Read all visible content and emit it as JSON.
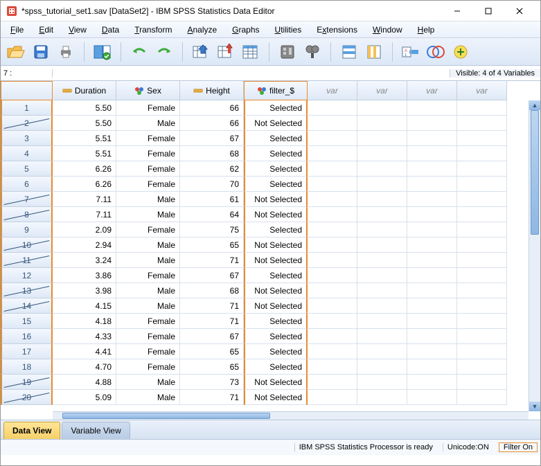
{
  "window": {
    "title": "*spss_tutorial_set1.sav [DataSet2] - IBM SPSS Statistics Data Editor"
  },
  "menu": [
    "File",
    "Edit",
    "View",
    "Data",
    "Transform",
    "Analyze",
    "Graphs",
    "Utilities",
    "Extensions",
    "Window",
    "Help"
  ],
  "location": {
    "label": "7 :",
    "value": "",
    "visible": "Visible: 4 of 4 Variables"
  },
  "columns": {
    "duration": "Duration",
    "sex": "Sex",
    "height": "Height",
    "filter": "filter_$",
    "empty": "var"
  },
  "rows": [
    {
      "n": "1",
      "struck": false,
      "duration": "5.50",
      "sex": "Female",
      "height": "66",
      "filter": "Selected"
    },
    {
      "n": "2",
      "struck": true,
      "duration": "5.50",
      "sex": "Male",
      "height": "66",
      "filter": "Not Selected"
    },
    {
      "n": "3",
      "struck": false,
      "duration": "5.51",
      "sex": "Female",
      "height": "67",
      "filter": "Selected"
    },
    {
      "n": "4",
      "struck": false,
      "duration": "5.51",
      "sex": "Female",
      "height": "68",
      "filter": "Selected"
    },
    {
      "n": "5",
      "struck": false,
      "duration": "6.26",
      "sex": "Female",
      "height": "62",
      "filter": "Selected"
    },
    {
      "n": "6",
      "struck": false,
      "duration": "6.26",
      "sex": "Female",
      "height": "70",
      "filter": "Selected"
    },
    {
      "n": "7",
      "struck": true,
      "duration": "7.11",
      "sex": "Male",
      "height": "61",
      "filter": "Not Selected"
    },
    {
      "n": "8",
      "struck": true,
      "duration": "7.11",
      "sex": "Male",
      "height": "64",
      "filter": "Not Selected"
    },
    {
      "n": "9",
      "struck": false,
      "duration": "2.09",
      "sex": "Female",
      "height": "75",
      "filter": "Selected"
    },
    {
      "n": "10",
      "struck": true,
      "duration": "2.94",
      "sex": "Male",
      "height": "65",
      "filter": "Not Selected"
    },
    {
      "n": "11",
      "struck": true,
      "duration": "3.24",
      "sex": "Male",
      "height": "71",
      "filter": "Not Selected"
    },
    {
      "n": "12",
      "struck": false,
      "duration": "3.86",
      "sex": "Female",
      "height": "67",
      "filter": "Selected"
    },
    {
      "n": "13",
      "struck": true,
      "duration": "3.98",
      "sex": "Male",
      "height": "68",
      "filter": "Not Selected"
    },
    {
      "n": "14",
      "struck": true,
      "duration": "4.15",
      "sex": "Male",
      "height": "71",
      "filter": "Not Selected"
    },
    {
      "n": "15",
      "struck": false,
      "duration": "4.18",
      "sex": "Female",
      "height": "71",
      "filter": "Selected"
    },
    {
      "n": "16",
      "struck": false,
      "duration": "4.33",
      "sex": "Female",
      "height": "67",
      "filter": "Selected"
    },
    {
      "n": "17",
      "struck": false,
      "duration": "4.41",
      "sex": "Female",
      "height": "65",
      "filter": "Selected"
    },
    {
      "n": "18",
      "struck": false,
      "duration": "4.70",
      "sex": "Female",
      "height": "65",
      "filter": "Selected"
    },
    {
      "n": "19",
      "struck": true,
      "duration": "4.88",
      "sex": "Male",
      "height": "73",
      "filter": "Not Selected"
    },
    {
      "n": "20",
      "struck": true,
      "duration": "5.09",
      "sex": "Male",
      "height": "71",
      "filter": "Not Selected"
    }
  ],
  "tabs": {
    "data": "Data View",
    "variable": "Variable View"
  },
  "status": {
    "processor": "IBM SPSS Statistics Processor is ready",
    "unicode": "Unicode:ON",
    "filter": "Filter On"
  }
}
